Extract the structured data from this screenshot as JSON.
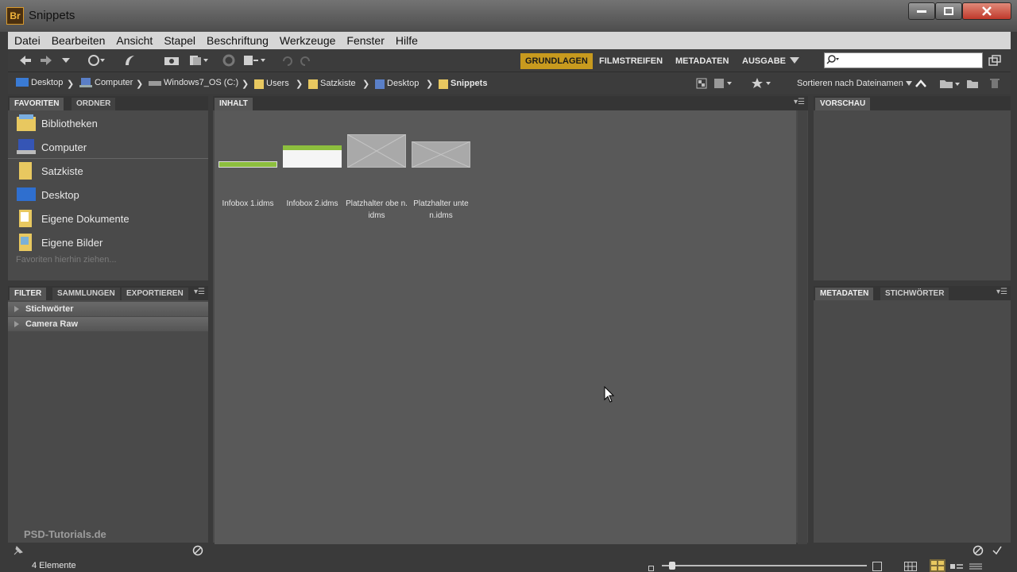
{
  "window": {
    "logo": "Br",
    "title": "Snippets"
  },
  "menu": [
    "Datei",
    "Bearbeiten",
    "Ansicht",
    "Stapel",
    "Beschriftung",
    "Werkzeuge",
    "Fenster",
    "Hilfe"
  ],
  "workspaces": {
    "grundlagen": "GRUNDLAGEN",
    "filmstreifen": "FILMSTREIFEN",
    "metadaten": "METADATEN",
    "ausgabe": "AUSGABE"
  },
  "search": {
    "placeholder": ""
  },
  "breadcrumb": [
    "Desktop",
    "Computer",
    "Windows7_OS (C:)",
    "Users",
    "Satzkiste",
    "Desktop",
    "Snippets"
  ],
  "sort": {
    "label": "Sortieren nach Dateinamen"
  },
  "favorites_panel": {
    "tab_favoriten": "FAVORITEN",
    "tab_ordner": "ORDNER",
    "items": [
      "Bibliotheken",
      "Computer",
      "Satzkiste",
      "Desktop",
      "Eigene Dokumente",
      "Eigene Bilder"
    ],
    "hint": "Favoriten hierhin ziehen..."
  },
  "filter_panel": {
    "tab_filter": "FILTER",
    "tab_sammlungen": "SAMMLUNGEN",
    "tab_exportieren": "EXPORTIEREN",
    "rows": [
      "Stichwörter",
      "Camera Raw"
    ]
  },
  "content_panel": {
    "tab": "INHALT",
    "files": [
      {
        "name": "Infobox 1.idms"
      },
      {
        "name": "Infobox 2.idms"
      },
      {
        "name": "Platzhalter obe n.idms"
      },
      {
        "name": "Platzhalter unte n.idms"
      }
    ]
  },
  "preview_panel": {
    "tab": "VORSCHAU"
  },
  "meta_panel": {
    "tab_metadaten": "METADATEN",
    "tab_stichwoerter": "STICHWÖRTER"
  },
  "status": {
    "count": "4 Elemente",
    "zoom_level": 0.05
  },
  "watermark": "PSD-Tutorials.de",
  "colors": {
    "accent": "#c89a1e",
    "panel": "#4a4a4a",
    "content": "#595959"
  }
}
